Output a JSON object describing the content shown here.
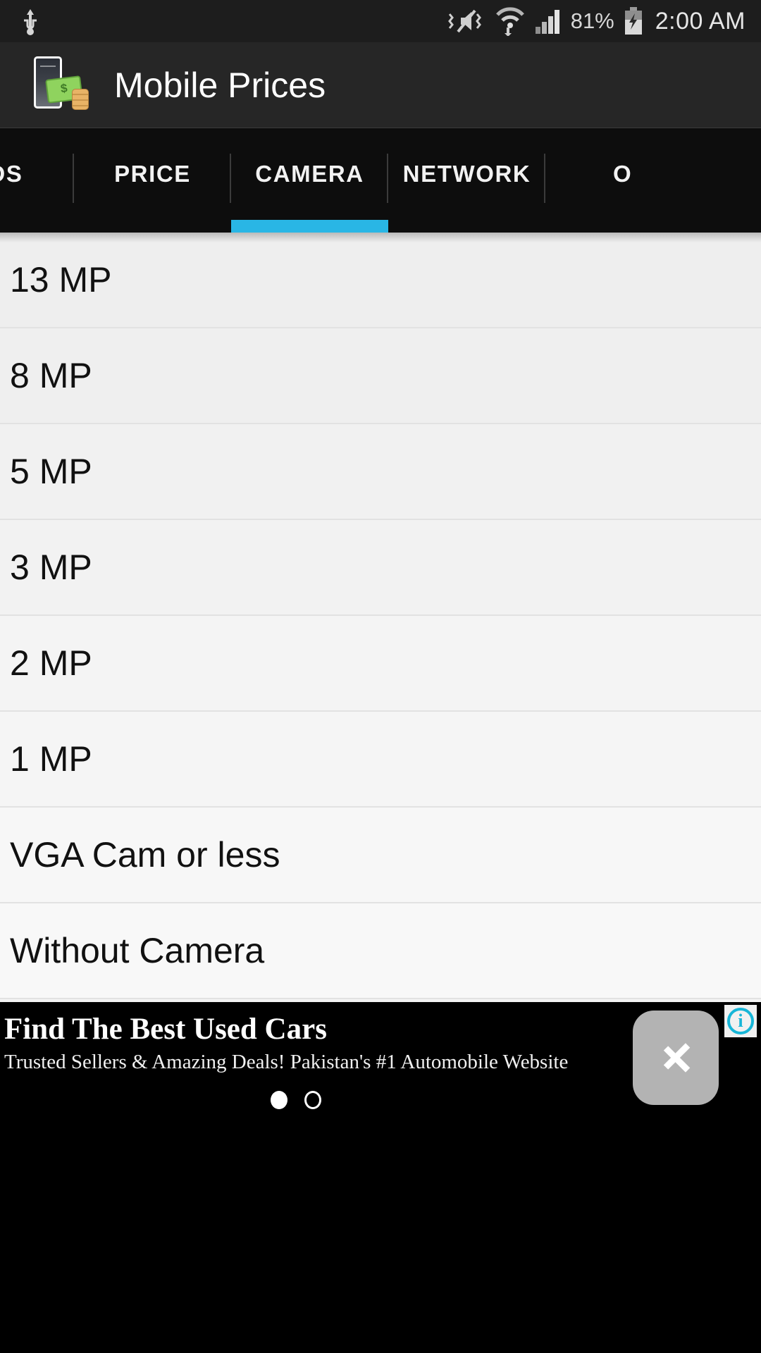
{
  "status_bar": {
    "usb_icon": "usb-icon",
    "mute_icon": "vibrate-mute-icon",
    "wifi_icon": "wifi-icon",
    "signal_icon": "cellular-signal-icon",
    "battery_percent": "81%",
    "battery_icon": "battery-charging-icon",
    "clock": "2:00 AM"
  },
  "action_bar": {
    "app_icon": "mobile-prices-app-icon",
    "title": "Mobile Prices"
  },
  "tabs": {
    "items": [
      {
        "label": "NDS",
        "selected": false,
        "partial": "left"
      },
      {
        "label": "PRICE",
        "selected": false,
        "partial": "none"
      },
      {
        "label": "CAMERA",
        "selected": true,
        "partial": "none"
      },
      {
        "label": "NETWORK",
        "selected": false,
        "partial": "none"
      },
      {
        "label": "O",
        "selected": false,
        "partial": "right"
      }
    ],
    "indicator_color": "#29b6e5"
  },
  "list": {
    "rows": [
      {
        "label": "13 MP"
      },
      {
        "label": "8 MP"
      },
      {
        "label": "5 MP"
      },
      {
        "label": "3 MP"
      },
      {
        "label": "2 MP"
      },
      {
        "label": "1 MP"
      },
      {
        "label": "VGA Cam or less"
      },
      {
        "label": "Without Camera"
      }
    ]
  },
  "ad": {
    "headline": "Find The Best Used Cars",
    "subtext": "Trusted Sellers & Amazing Deals! Pakistan's #1 Automobile Website",
    "cta_icon": "chevron-right-icon",
    "adchoices_icon": "adchoices-info-icon",
    "adchoices_letter": "i",
    "carousel": {
      "total": 2,
      "active_index": 0
    }
  },
  "colors": {
    "accent": "#29b6e5",
    "status_bar_bg": "#1d1d1d",
    "action_bar_bg": "#262626",
    "tab_bar_bg": "#0d0d0d",
    "list_bg": "#f4f4f4",
    "ad_bg": "#000000",
    "adchoices": "#17b6d8"
  }
}
